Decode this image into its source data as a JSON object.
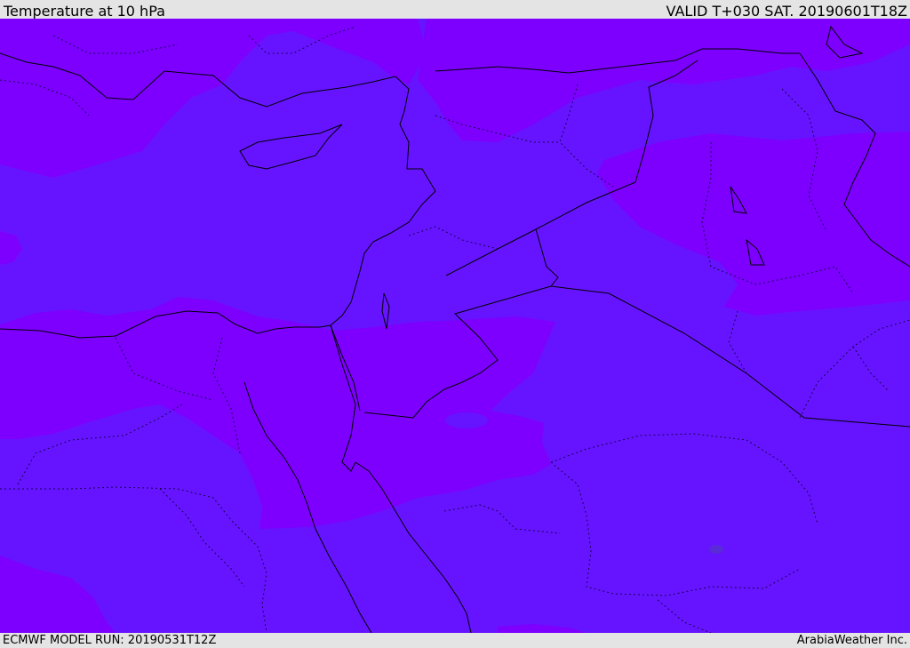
{
  "header": {
    "title": "Temperature at 10 hPa",
    "valid": "VALID T+030 SAT. 20190601T18Z"
  },
  "footer": {
    "model_run": "ECMWF MODEL RUN: 20190531T12Z",
    "credit": "ArabiaWeather Inc."
  },
  "map": {
    "colors": {
      "base": "#6614ff",
      "warm_band": "#7d00ff",
      "coastline": "#000000",
      "border": "#1a0050"
    }
  }
}
